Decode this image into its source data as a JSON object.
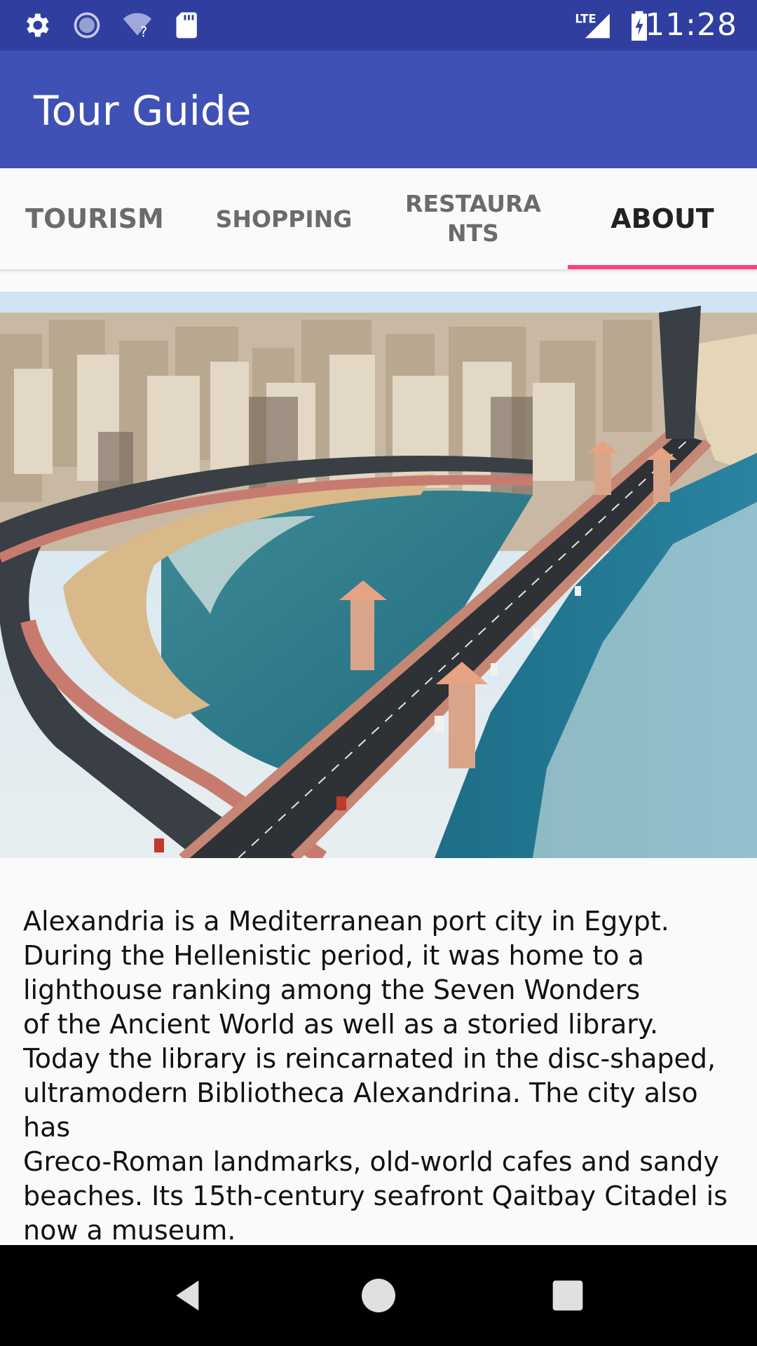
{
  "status_bar": {
    "time": "11:28",
    "network_label": "LTE",
    "icons": [
      "gear-icon",
      "sync-icon",
      "wifi-unknown-icon",
      "sd-card-icon",
      "lte-signal-icon",
      "battery-charging-icon"
    ]
  },
  "app_bar": {
    "title": "Tour Guide"
  },
  "tabs": [
    {
      "label": "TOURISM",
      "active": false
    },
    {
      "label": "SHOPPING",
      "active": false
    },
    {
      "label": "RESTAURA\nNTS",
      "active": false
    },
    {
      "label": "ABOUT",
      "active": true
    }
  ],
  "colors": {
    "status_bar": "#303f9f",
    "app_bar": "#3f51b5",
    "tab_indicator": "#ff4081"
  },
  "about": {
    "image_subject": "Aerial view of Alexandria corniche with Stanley Bridge",
    "description": "     Alexandria is a Mediterranean port city in Egypt.\nDuring the Hellenistic period, it was home to a\nlighthouse ranking among the Seven Wonders\nof the Ancient World as well as a storied library.\nToday the library is reincarnated in the disc-shaped,\nultramodern Bibliotheca Alexandrina. The city also has\nGreco-Roman landmarks, old-world cafes and sandy\nbeaches. Its 15th-century seafront Qaitbay Citadel is\nnow a museum."
  },
  "nav_bar": {
    "buttons": [
      "back-icon",
      "home-icon",
      "recents-icon"
    ]
  }
}
